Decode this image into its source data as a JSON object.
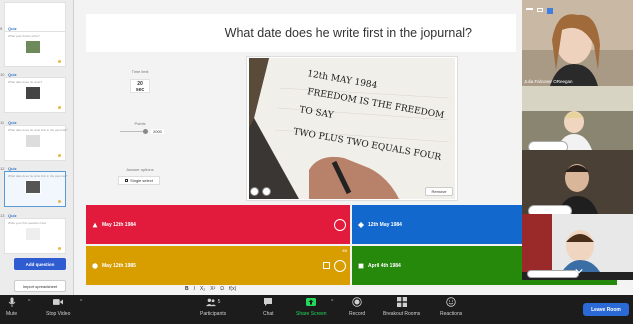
{
  "sidebar": {
    "slides": [
      {
        "num": "8",
        "label": "Quiz",
        "text": "",
        "has_image": false
      },
      {
        "num": "9",
        "label": "Quiz",
        "text": "What year did he write?",
        "has_image": true
      },
      {
        "num": "10",
        "label": "Quiz",
        "text": "What date does he write?",
        "has_image": true
      },
      {
        "num": "11",
        "label": "Quiz",
        "text": "What date does he write first in the jopurnal?",
        "has_image": false
      },
      {
        "num": "12",
        "label": "Quiz",
        "text": "What date does he write first in the jopurnal?",
        "has_image": true
      },
      {
        "num": "13",
        "label": "Quiz",
        "text": "Write your first question here",
        "has_image": false
      }
    ],
    "add_question": "Add question",
    "import_spreadsheet": "Import spreadsheet"
  },
  "question": {
    "text": "What date does he write first in the jopurnal?"
  },
  "settings": {
    "time_label": "Time limit",
    "time_value": "20",
    "time_unit": "sec",
    "points_label": "Points",
    "points_value": "2000",
    "answer_options_label": "Answer options",
    "answer_option_value": "Single select"
  },
  "media": {
    "remove_label": "Remove",
    "photo_text_line1": "12th MAY 1984",
    "photo_text_line2": "FREEDOM IS THE FREEDOM",
    "photo_text_line3": "TO SAY",
    "photo_text_line4": "TWO PLUS TWO EQUALS FOUR"
  },
  "answers": [
    {
      "text": "May 12th 1984",
      "color": "#e21b3c",
      "shape": "triangle"
    },
    {
      "text": "12th May 1984",
      "color": "#1368ce",
      "shape": "diamond"
    },
    {
      "text": "May 12th 1985",
      "color": "#d89e00",
      "shape": "circle",
      "count": "60"
    },
    {
      "text": "April 4th 1984",
      "color": "#26890c",
      "shape": "square"
    }
  ],
  "format_toolbar": {
    "bold": "B",
    "italic": "I",
    "subscript": "X₂",
    "superscript": "X²",
    "omega": "Ω",
    "fx": "f(x)"
  },
  "video": {
    "tile1_name": "Julia Falconer OReegan"
  },
  "zoom_bar": {
    "mute": "Mute",
    "stop_video": "Stop Video",
    "participants": "Participants",
    "participants_count": "5",
    "chat": "Chat",
    "share_screen": "Share Screen",
    "record": "Record",
    "breakout_rooms": "Breakout Rooms",
    "reactions": "Reactions",
    "leave_room": "Leave Room"
  },
  "colors": {
    "share_green": "#23d959",
    "leave_blue": "#2b6ad6"
  }
}
